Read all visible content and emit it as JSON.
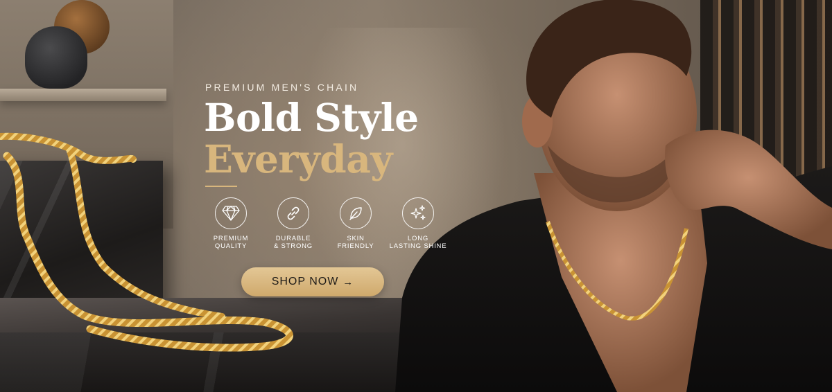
{
  "banner": {
    "eyebrow": "PREMIUM MEN'S CHAIN",
    "headline_line1": "Bold Style",
    "headline_line2": "Everyday",
    "accent_color": "#d8b67d"
  },
  "features": [
    {
      "icon": "diamond-icon",
      "label": "PREMIUM\nQUALITY"
    },
    {
      "icon": "chain-link-icon",
      "label": "DURABLE\n& STRONG"
    },
    {
      "icon": "leaf-icon",
      "label": "SKIN\nFRIENDLY"
    },
    {
      "icon": "sparkles-icon",
      "label": "LONG\nLASTING SHINE"
    }
  ],
  "cta": {
    "label": "SHOP NOW",
    "arrow": "→",
    "color": "#d9b77f"
  }
}
